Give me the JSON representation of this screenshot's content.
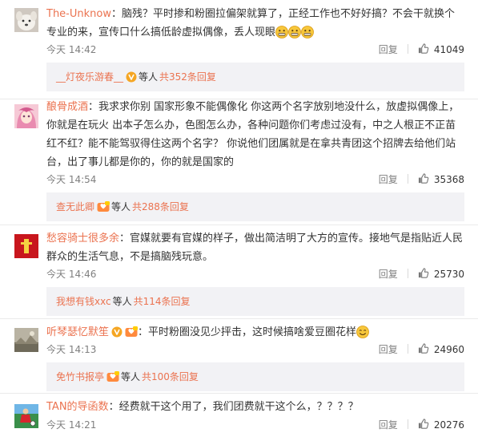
{
  "colors": {
    "username": "#eb7350",
    "text": "#333333",
    "meta": "#808080",
    "replies_bg": "#f2f2f5",
    "divider": "#eaeaea"
  },
  "comments": [
    {
      "avatar_icon": "white-puppy-avatar",
      "username": "The-Unknow",
      "text": "脑残？平时掺和粉圈拉偏架就算了，正经工作也不好好搞？不会干就换个专业的来，宣传口什么搞低龄虚拟偶像，丢人现眼",
      "emojis": [
        "grimace-emoji",
        "grimace-emoji",
        "grimace-emoji"
      ],
      "time": "今天 14:42",
      "reply_label": "回复",
      "likes": "41049",
      "replies": {
        "name": "__灯夜乐游春__",
        "badge": "vip-v-badge",
        "etc": "等人",
        "link": "共352条回复"
      }
    },
    {
      "avatar_icon": "anime-girl-avatar",
      "username": "酿骨成酒",
      "text": "我求求你别 国家形象不能偶像化 你这两个名字放别地没什么，放虚拟偶像上，你就是在玩火 出本子怎么办，色图怎么办，各种问题你们考虑过没有，中之人根正不正苗红不红？能不能驾驭得住这两个名字？ 你说他们团属就是在拿共青团这个招牌去给他们站台，出了事儿都是你的，你的就是国家的",
      "time": "今天 14:54",
      "reply_label": "回复",
      "likes": "35368",
      "replies": {
        "name": "查无此卿",
        "badge": "fan-badge",
        "etc": "等人",
        "link": "共288条回复"
      }
    },
    {
      "avatar_icon": "red-poster-avatar",
      "username": "愁容骑士很多余",
      "text": "官媒就要有官媒的样子，做出简洁明了大方的宣传。接地气是指贴近人民群众的生活气息，不是搞脑残玩意。",
      "time": "今天 14:46",
      "reply_label": "回复",
      "likes": "25730",
      "replies": {
        "name": "我想有钱xxc",
        "etc": "等人",
        "link": "共114条回复"
      }
    },
    {
      "avatar_icon": "landscape-avatar",
      "username": "听琴瑟忆默笙",
      "badges": [
        "vip-v-badge",
        "fan-badge"
      ],
      "text": "平时粉圈没见少抨击，这时候搞啥爱豆圈花样",
      "emojis": [
        "smile-emoji"
      ],
      "time": "今天 14:13",
      "reply_label": "回复",
      "likes": "24960",
      "replies": {
        "name": "免竹书报亭",
        "badge": "fan-badge",
        "etc": "等人",
        "link": "共100条回复"
      }
    },
    {
      "avatar_icon": "soccer-player-avatar",
      "username": "TAN的导函数",
      "text": "经费就干这个用了，我们团费就干这个么，？？？？",
      "time": "今天 14:21",
      "reply_label": "回复",
      "likes": "20276"
    }
  ]
}
